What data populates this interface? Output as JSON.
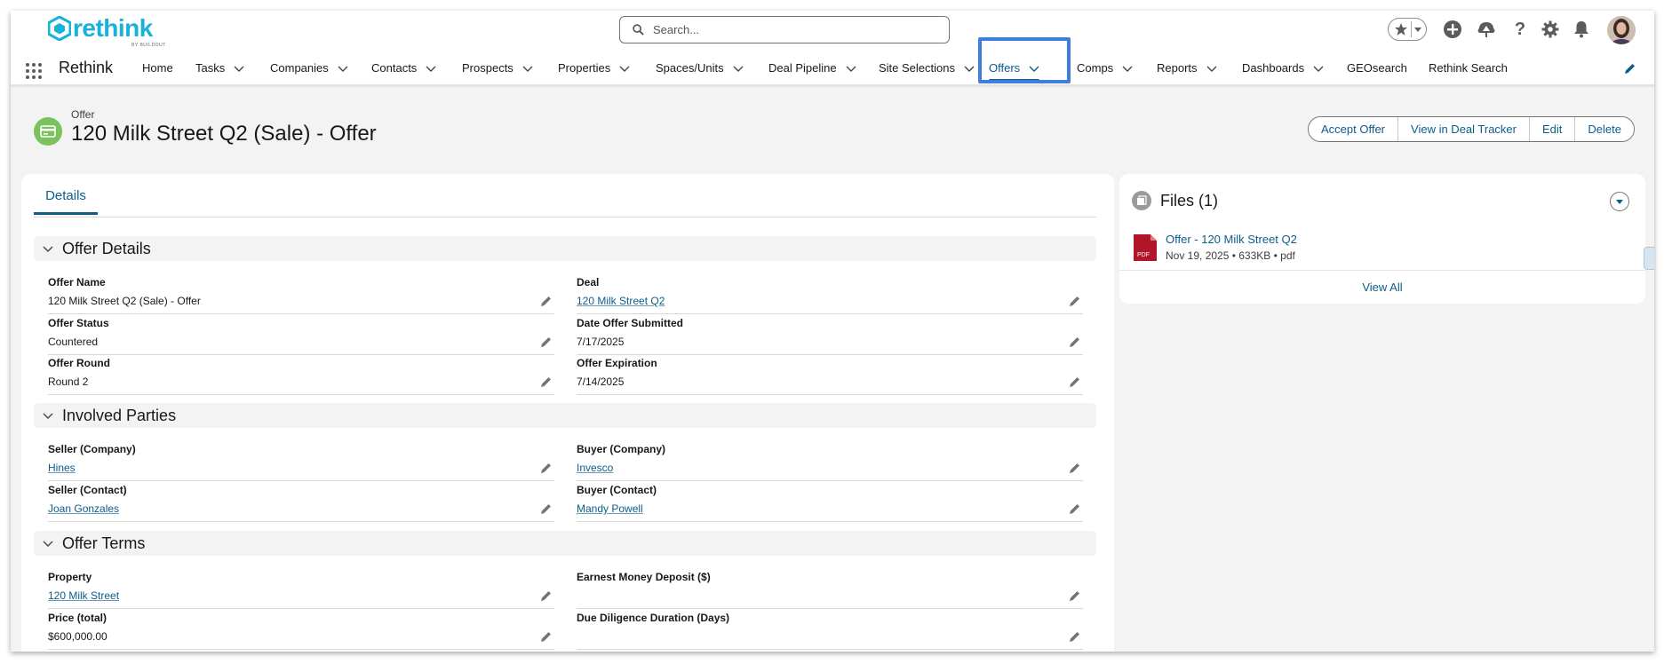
{
  "brand": {
    "logo_text": "rethink",
    "logo_sub": "BY BUILDOUT",
    "app_name": "Rethink",
    "accent": "#17b2d8",
    "link_color": "#0b5d8a"
  },
  "search": {
    "placeholder": "Search..."
  },
  "utility_icons": [
    "favorites-star-icon",
    "add-icon",
    "trailhead-icon",
    "help-icon",
    "setup-gear-icon",
    "notifications-bell-icon",
    "user-avatar"
  ],
  "nav": {
    "items": [
      {
        "label": "Home"
      },
      {
        "label": "Tasks"
      },
      {
        "label": "Companies"
      },
      {
        "label": "Contacts"
      },
      {
        "label": "Prospects"
      },
      {
        "label": "Properties"
      },
      {
        "label": "Spaces/Units"
      },
      {
        "label": "Deal Pipeline"
      },
      {
        "label": "Site Selections"
      },
      {
        "label": "Offers",
        "active": true
      },
      {
        "label": "Comps"
      },
      {
        "label": "Reports"
      },
      {
        "label": "Dashboards"
      },
      {
        "label": "GEOsearch"
      },
      {
        "label": "Rethink Search"
      }
    ]
  },
  "record": {
    "object_label": "Offer",
    "title": "120 Milk Street Q2 (Sale) - Offer",
    "actions": [
      "Accept Offer",
      "View in Deal Tracker",
      "Edit",
      "Delete"
    ]
  },
  "tabs": {
    "details": "Details"
  },
  "sections": {
    "offer_details": {
      "title": "Offer Details",
      "fields": {
        "offer_name": {
          "label": "Offer Name",
          "value": "120 Milk Street Q2 (Sale) - Offer"
        },
        "deal": {
          "label": "Deal",
          "value": "120 Milk Street Q2"
        },
        "offer_status": {
          "label": "Offer Status",
          "value": "Countered"
        },
        "date_submitted": {
          "label": "Date Offer Submitted",
          "value": "7/17/2025"
        },
        "offer_round": {
          "label": "Offer Round",
          "value": "Round 2"
        },
        "offer_expiration": {
          "label": "Offer Expiration",
          "value": "7/14/2025"
        }
      }
    },
    "involved_parties": {
      "title": "Involved Parties",
      "fields": {
        "seller_company": {
          "label": "Seller (Company)",
          "value": "Hines"
        },
        "buyer_company": {
          "label": "Buyer (Company)",
          "value": "Invesco"
        },
        "seller_contact": {
          "label": "Seller (Contact)",
          "value": "Joan Gonzales"
        },
        "buyer_contact": {
          "label": "Buyer (Contact)",
          "value": "Mandy Powell"
        }
      }
    },
    "offer_terms": {
      "title": "Offer Terms",
      "fields": {
        "property": {
          "label": "Property",
          "value": "120 Milk Street"
        },
        "earnest_money": {
          "label": "Earnest Money Deposit ($)",
          "value": ""
        },
        "price_total": {
          "label": "Price (total)",
          "value": "$600,000.00"
        },
        "due_diligence": {
          "label": "Due Diligence Duration (Days)",
          "value": ""
        }
      }
    }
  },
  "files": {
    "title": "Files (1)",
    "items": [
      {
        "name": "Offer - 120 Milk Street Q2",
        "meta": "Nov 19, 2025 • 633KB • pdf",
        "icon_text": "PDF"
      }
    ],
    "view_all": "View All"
  }
}
